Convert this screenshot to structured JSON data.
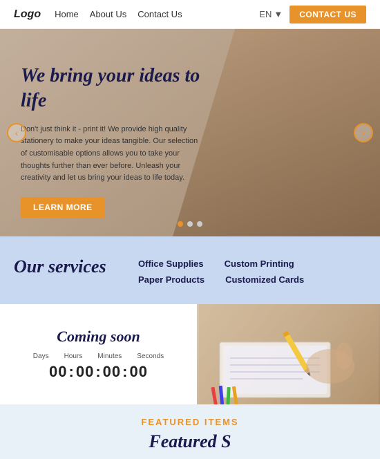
{
  "nav": {
    "logo": "Logo",
    "links": [
      "Home",
      "About Us",
      "Contact Us"
    ],
    "lang": "EN",
    "contact_btn": "CONTACT US"
  },
  "hero": {
    "title": "We bring your ideas to life",
    "description": "Don't just think it - print it! We provide high quality stationery to make your ideas tangible. Our selection of customisable options allows you to take your thoughts further than ever before. Unleash your creativity and let us bring your ideas to life today.",
    "cta_label": "LEARN MORE",
    "dots": [
      "active",
      "inactive",
      "inactive"
    ]
  },
  "services": {
    "title": "Our services",
    "links": [
      "Office Supplies",
      "Custom Printing",
      "Paper Products",
      "Customized Cards"
    ]
  },
  "coming_soon": {
    "title": "Coming soon",
    "timer_labels": [
      "Days",
      "Hours",
      "Minutes",
      "Seconds"
    ],
    "timer_values": [
      "00",
      "00",
      "00",
      "00"
    ]
  },
  "featured": {
    "label": "FEATURED ITEMS",
    "title_partial": "Featured S"
  }
}
